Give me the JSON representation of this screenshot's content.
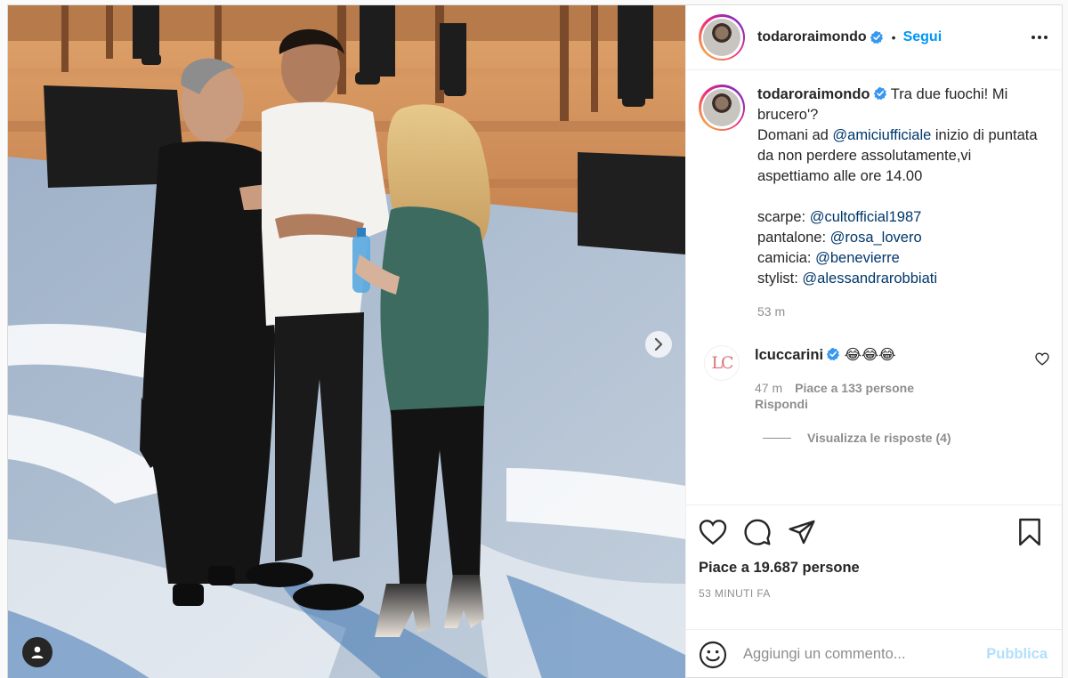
{
  "post": {
    "username": "todaroraimondo",
    "dot": "•",
    "follow_label": "Segui",
    "caption": {
      "username": "todaroraimondo",
      "text_1": "Tra due fuochi! Mi brucero'?",
      "text_2": "Domani ad ",
      "mention_main": "@amiciufficiale",
      "text_3": " inizio di puntata da non perdere assolutamente,vi aspettiamo alle ore 14.00",
      "credits": [
        {
          "label": "scarpe: ",
          "mention": "@cultofficial1987"
        },
        {
          "label": "pantalone: ",
          "mention": "@rosa_lovero"
        },
        {
          "label": "camicia: ",
          "mention": "@benevierre"
        },
        {
          "label": "stylist: ",
          "mention": "@alessandrarobbiati"
        }
      ],
      "time": "53 m"
    },
    "comment": {
      "username": "lcuccarini",
      "avatar_text": "LC",
      "text": "😂😂😂",
      "time": "47 m",
      "likes": "Piace a 133 persone",
      "reply_label": "Rispondi",
      "view_replies": "Visualizza le risposte (4)"
    },
    "likes_text": "Piace a 19.687 persone",
    "time_ago": "53 MINUTI FA",
    "add_comment_placeholder": "Aggiungi un commento...",
    "publish_label": "Pubblica"
  },
  "icons": {
    "heart": "heart-icon",
    "comment": "comment-icon",
    "share": "share-icon",
    "save": "bookmark-icon",
    "smile": "emoji-icon",
    "verified": "verified-badge-icon",
    "more": "more-options-icon",
    "next": "chevron-right-icon",
    "tag": "user-tag-icon"
  },
  "colors": {
    "link_blue": "#0095f6",
    "mention": "#00376b",
    "muted": "#8e8e8e",
    "publish_disabled": "#b2dffc"
  }
}
